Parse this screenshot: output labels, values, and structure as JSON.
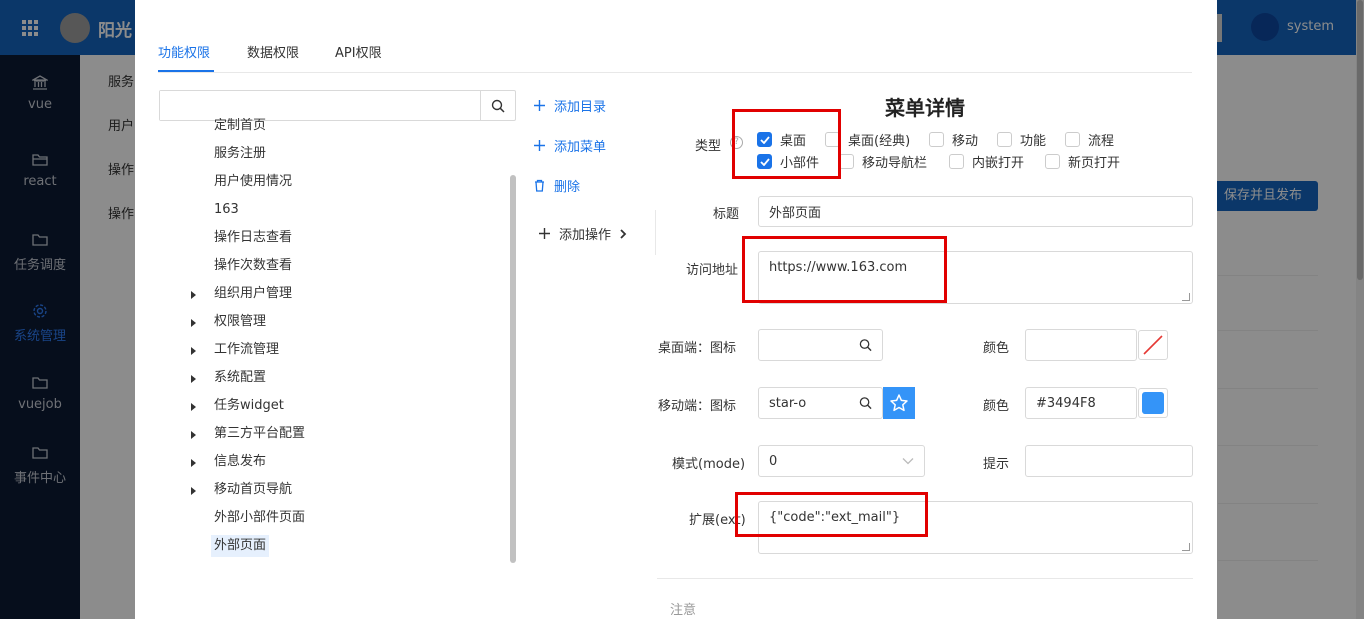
{
  "app": {
    "title": "阳光",
    "user": "system",
    "publish_button": "保存并且发布"
  },
  "sidebar": {
    "items": [
      {
        "label": "vue",
        "icon": "bank-icon"
      },
      {
        "label": "react",
        "icon": "folder-icon"
      },
      {
        "label": "任务调度",
        "icon": "folder-icon"
      },
      {
        "label": "系统管理",
        "icon": "gear-icon",
        "active": true
      },
      {
        "label": "vuejob",
        "icon": "folder-icon"
      },
      {
        "label": "事件中心",
        "icon": "folder-icon"
      }
    ]
  },
  "background_rows": [
    "服务",
    "用户",
    "操作",
    "操作"
  ],
  "tabs": [
    "功能权限",
    "数据权限",
    "API权限"
  ],
  "tree": {
    "search_placeholder": "",
    "items": [
      {
        "label": "定制首页",
        "expandable": false
      },
      {
        "label": "服务注册",
        "expandable": false
      },
      {
        "label": "用户使用情况",
        "expandable": false
      },
      {
        "label": "163",
        "expandable": false
      },
      {
        "label": "操作日志查看",
        "expandable": false
      },
      {
        "label": "操作次数查看",
        "expandable": false
      },
      {
        "label": "组织用户管理",
        "expandable": true
      },
      {
        "label": "权限管理",
        "expandable": true
      },
      {
        "label": "工作流管理",
        "expandable": true
      },
      {
        "label": "系统配置",
        "expandable": true
      },
      {
        "label": "任务widget",
        "expandable": true
      },
      {
        "label": "第三方平台配置",
        "expandable": true
      },
      {
        "label": "信息发布",
        "expandable": true
      },
      {
        "label": "移动首页导航",
        "expandable": true
      },
      {
        "label": "外部小部件页面",
        "expandable": false
      },
      {
        "label": "外部页面",
        "expandable": false,
        "selected": true
      }
    ]
  },
  "actions": {
    "add_directory": "添加目录",
    "add_menu": "添加菜单",
    "delete": "删除",
    "add_operation": "添加操作"
  },
  "details": {
    "title": "菜单详情",
    "type_label": "类型",
    "type_options": [
      {
        "label": "桌面",
        "checked": true
      },
      {
        "label": "桌面(经典)",
        "checked": false
      },
      {
        "label": "移动",
        "checked": false
      },
      {
        "label": "功能",
        "checked": false
      },
      {
        "label": "流程",
        "checked": false
      },
      {
        "label": "小部件",
        "checked": true
      },
      {
        "label": "移动导航栏",
        "checked": false
      },
      {
        "label": "内嵌打开",
        "checked": false
      },
      {
        "label": "新页打开",
        "checked": false
      }
    ],
    "title_label": "标题",
    "title_value": "外部页面",
    "url_label": "访问地址",
    "url_value": "https://www.163.com",
    "desktop_icon_label": "桌面端：图标",
    "desktop_icon_value": "",
    "color_label": "颜色",
    "desktop_color_value": "",
    "mobile_icon_label": "移动端：图标",
    "mobile_icon_value": "star-o",
    "mobile_color_value": "#3494F8",
    "mode_label": "模式(mode)",
    "mode_value": "0",
    "hint_label": "提示",
    "hint_value": "",
    "ext_label": "扩展(ext)",
    "ext_value": "{\"code\":\"ext_mail\"}",
    "note_label": "注意"
  },
  "colors": {
    "accent": "#1a73e8",
    "header": "#1565c0",
    "sidebar": "#0b1a33",
    "highlight_box": "#e10000",
    "mobile_color": "#3494F8"
  }
}
